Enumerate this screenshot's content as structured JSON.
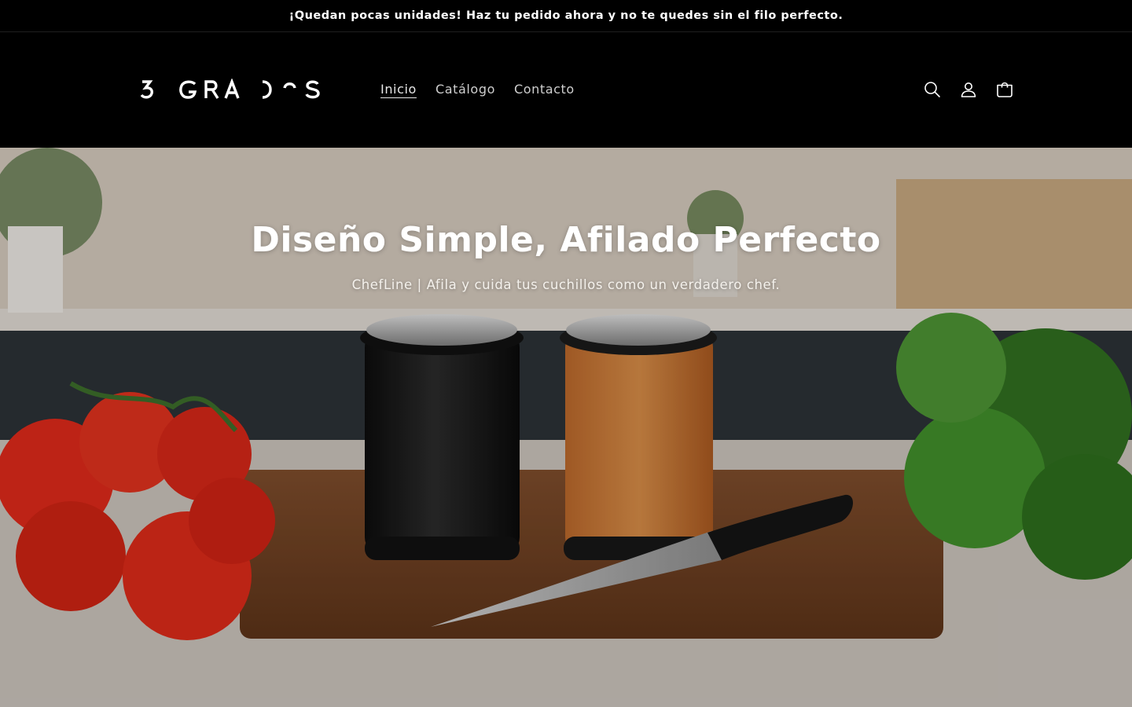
{
  "announcement": {
    "text": "¡Quedan pocas unidades! Haz tu pedido ahora y no te quedes sin el filo perfecto."
  },
  "header": {
    "logo_text": "3 GRADOS",
    "nav": [
      {
        "label": "Inicio",
        "active": true
      },
      {
        "label": "Catálogo",
        "active": false
      },
      {
        "label": "Contacto",
        "active": false
      }
    ],
    "icons": [
      "search-icon",
      "account-icon",
      "cart-icon"
    ]
  },
  "hero": {
    "title": "Diseño Simple, Afilado Perfecto",
    "subtitle": "ChefLine | Afila y cuida tus cuchillos como un verdadero chef."
  },
  "colors": {
    "background": "#000000",
    "text": "#ffffff",
    "nav_text": "#cfcfcf"
  }
}
